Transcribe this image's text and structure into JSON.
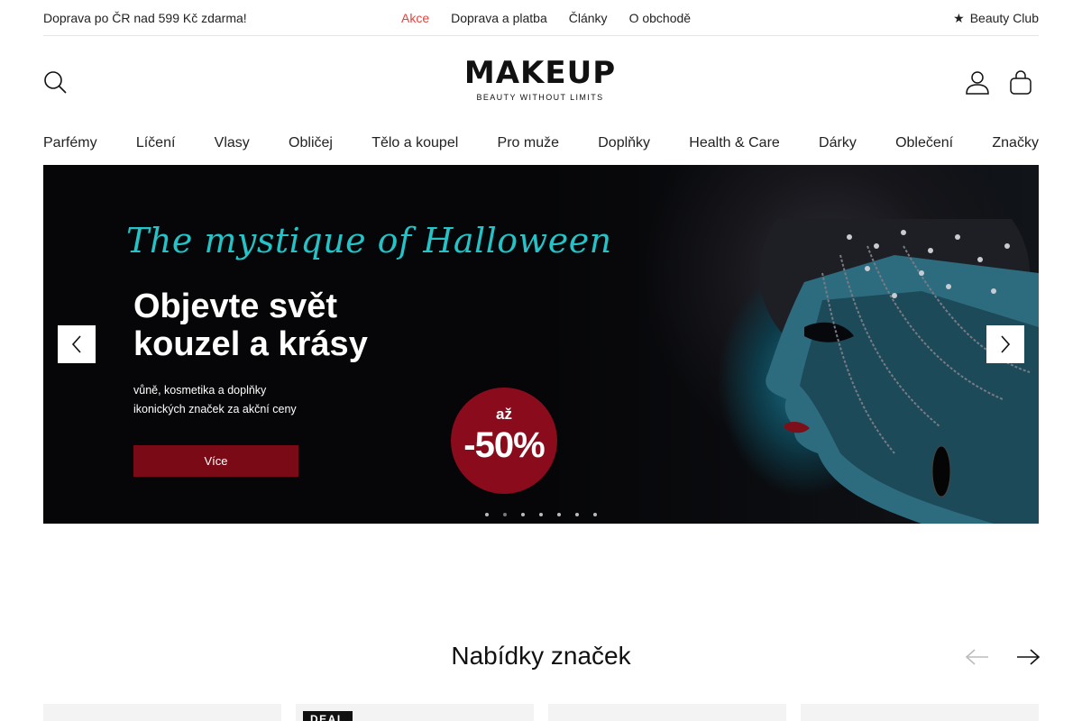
{
  "topbar": {
    "promo": "Doprava po ČR nad 599 Kč zdarma!",
    "links": [
      "Akce",
      "Doprava a platba",
      "Články",
      "O obchodě"
    ],
    "club_label": "Beauty Club"
  },
  "header": {
    "logo_word": "MAKEUP",
    "logo_tagline": "BEAUTY WITHOUT LIMITS"
  },
  "nav": {
    "items": [
      "Parfémy",
      "Líčení",
      "Vlasy",
      "Obličej",
      "Tělo a koupel",
      "Pro muže",
      "Doplňky",
      "Health & Care",
      "Dárky",
      "Oblečení",
      "Značky"
    ]
  },
  "hero": {
    "script_title": "The mystique of Halloween",
    "headline_line1": "Objevte svět",
    "headline_line2": "kouzel a krásy",
    "sub_line1": "vůně, kosmetika a doplňky",
    "sub_line2": "ikonických značek za akční ceny",
    "cta_label": "Více",
    "badge_small": "až",
    "badge_big": "-50%",
    "slides_total": 7,
    "active_slide": 1
  },
  "brand_offers": {
    "title": "Nabídky značek",
    "card_badge": "DEAL"
  },
  "colors": {
    "sale_link": "#e8413c",
    "cta": "#7a0b16",
    "badge": "#8a0b1c",
    "script": "#23c3c7"
  }
}
